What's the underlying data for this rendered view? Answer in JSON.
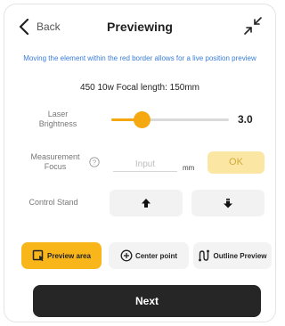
{
  "header": {
    "back_label": "Back",
    "title": "Previewing"
  },
  "notice": "Moving the element within the red border allows for a live position preview",
  "laser_info": "450 10w Focal length: 150mm",
  "brightness": {
    "label": "Laser Brightness",
    "value_text": "3.0",
    "fraction": 0.26
  },
  "measurement": {
    "label": "Measurement Focus",
    "placeholder": "Input",
    "value": "",
    "unit": "mm",
    "ok_label": "OK"
  },
  "control_stand": {
    "label": "Control Stand",
    "up_icon": "arrow-up-icon",
    "down_icon": "arrow-down-icon"
  },
  "modes": {
    "preview_area": "Preview area",
    "center_point": "Center point",
    "outline_preview": "Outline Preview",
    "active": "preview_area"
  },
  "next_label": "Next",
  "colors": {
    "accent": "#f5a80f",
    "notice": "#3a7cd6",
    "ok_bg": "#fbe6a4",
    "primary_button": "#262626"
  }
}
